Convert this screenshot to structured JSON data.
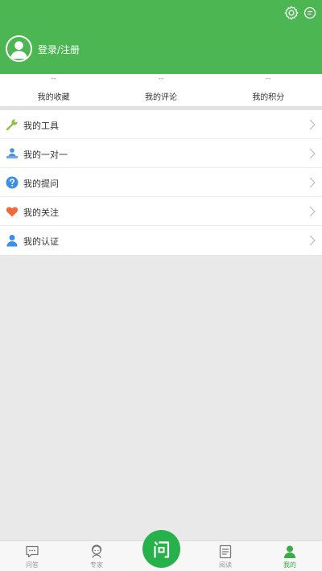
{
  "header": {
    "login_label": "登录/注册",
    "icons": [
      "settings-icon",
      "message-icon"
    ],
    "accent": "#4cb652"
  },
  "stats": [
    {
      "value": "--",
      "label": "我的收藏"
    },
    {
      "value": "--",
      "label": "我的评论"
    },
    {
      "value": "--",
      "label": "我的积分"
    }
  ],
  "menu": [
    {
      "label": "我的工具",
      "icon": "wrench-icon"
    },
    {
      "label": "我的一对一",
      "icon": "person-desk-icon"
    },
    {
      "label": "我的提问",
      "icon": "question-icon"
    },
    {
      "label": "我的关注",
      "icon": "heart-icon"
    },
    {
      "label": "我的认证",
      "icon": "user-icon"
    }
  ],
  "tabbar": {
    "tabs": [
      {
        "label": "问答",
        "icon": "chat-icon"
      },
      {
        "label": "专家",
        "icon": "expert-icon"
      },
      {
        "label": "问",
        "icon": "ask-icon"
      },
      {
        "label": "阅读",
        "icon": "document-icon"
      },
      {
        "label": "我的",
        "icon": "profile-icon"
      }
    ],
    "active": "我的",
    "active_color": "#3aad48"
  }
}
